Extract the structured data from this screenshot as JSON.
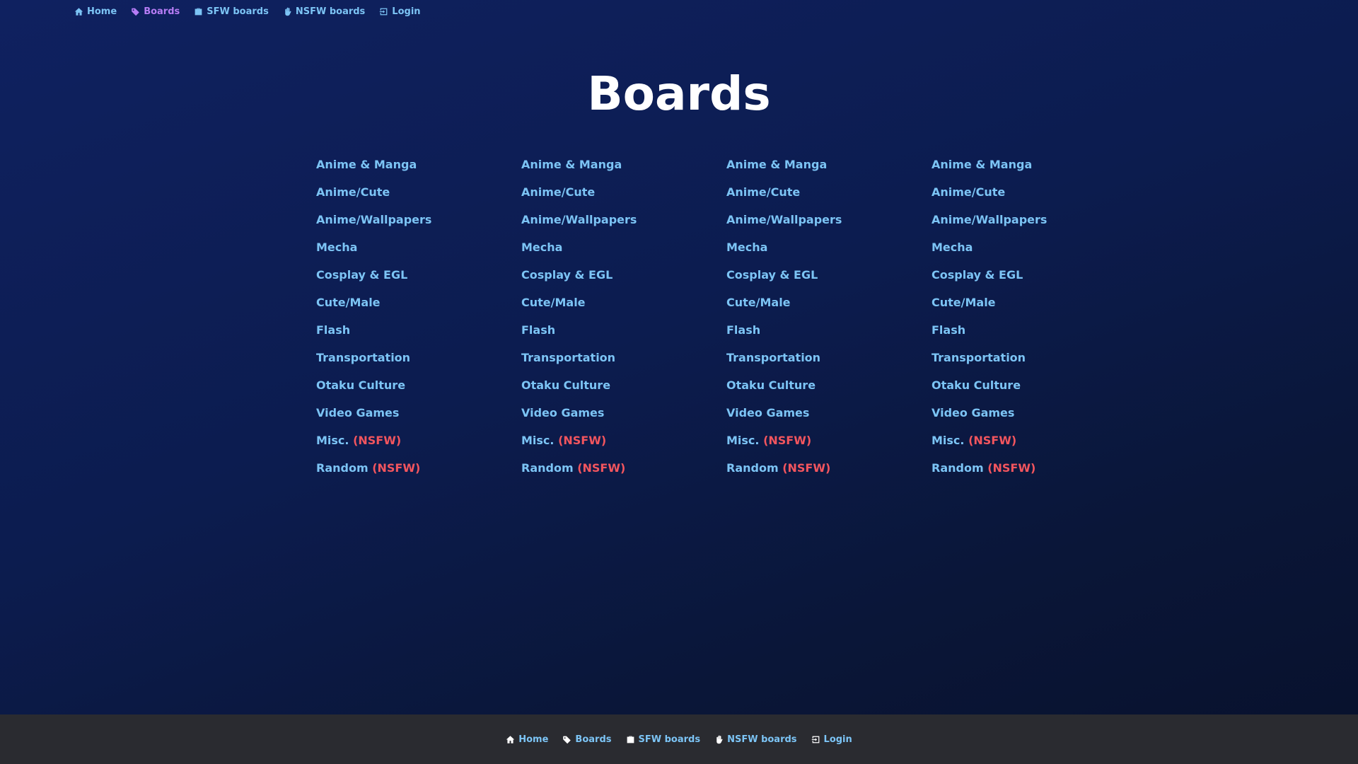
{
  "nav": {
    "items": [
      {
        "label": "Home",
        "icon": "home-icon"
      },
      {
        "label": "Boards",
        "icon": "tag-icon",
        "active": true
      },
      {
        "label": "SFW boards",
        "icon": "briefcase-icon"
      },
      {
        "label": "NSFW boards",
        "icon": "hand-icon"
      },
      {
        "label": "Login",
        "icon": "login-icon"
      }
    ]
  },
  "title": "Boards",
  "boards": {
    "columns": [
      [
        {
          "label": "Anime & Manga"
        },
        {
          "label": "Anime/Cute"
        },
        {
          "label": "Anime/Wallpapers"
        },
        {
          "label": "Mecha"
        },
        {
          "label": "Cosplay & EGL"
        },
        {
          "label": "Cute/Male"
        },
        {
          "label": "Flash"
        },
        {
          "label": "Transportation"
        },
        {
          "label": "Otaku Culture"
        },
        {
          "label": "Video Games"
        },
        {
          "label": "Misc.",
          "tag": "(NSFW)"
        },
        {
          "label": "Random",
          "tag": "(NSFW)"
        }
      ],
      [
        {
          "label": "Anime & Manga"
        },
        {
          "label": "Anime/Cute"
        },
        {
          "label": "Anime/Wallpapers"
        },
        {
          "label": "Mecha"
        },
        {
          "label": "Cosplay & EGL"
        },
        {
          "label": "Cute/Male"
        },
        {
          "label": "Flash"
        },
        {
          "label": "Transportation"
        },
        {
          "label": "Otaku Culture"
        },
        {
          "label": "Video Games"
        },
        {
          "label": "Misc.",
          "tag": "(NSFW)"
        },
        {
          "label": "Random",
          "tag": "(NSFW)"
        }
      ],
      [
        {
          "label": "Anime & Manga"
        },
        {
          "label": "Anime/Cute"
        },
        {
          "label": "Anime/Wallpapers"
        },
        {
          "label": "Mecha"
        },
        {
          "label": "Cosplay & EGL"
        },
        {
          "label": "Cute/Male"
        },
        {
          "label": "Flash"
        },
        {
          "label": "Transportation"
        },
        {
          "label": "Otaku Culture"
        },
        {
          "label": "Video Games"
        },
        {
          "label": "Misc.",
          "tag": "(NSFW)"
        },
        {
          "label": "Random",
          "tag": "(NSFW)"
        }
      ],
      [
        {
          "label": "Anime & Manga"
        },
        {
          "label": "Anime/Cute"
        },
        {
          "label": "Anime/Wallpapers"
        },
        {
          "label": "Mecha"
        },
        {
          "label": "Cosplay & EGL"
        },
        {
          "label": "Cute/Male"
        },
        {
          "label": "Flash"
        },
        {
          "label": "Transportation"
        },
        {
          "label": "Otaku Culture"
        },
        {
          "label": "Video Games"
        },
        {
          "label": "Misc.",
          "tag": "(NSFW)"
        },
        {
          "label": "Random",
          "tag": "(NSFW)"
        }
      ]
    ]
  },
  "footer": {
    "items": [
      {
        "label": "Home",
        "icon": "home-icon"
      },
      {
        "label": "Boards",
        "icon": "tag-icon"
      },
      {
        "label": "SFW boards",
        "icon": "briefcase-icon"
      },
      {
        "label": "NSFW boards",
        "icon": "hand-icon"
      },
      {
        "label": "Login",
        "icon": "login-icon"
      }
    ]
  },
  "colors": {
    "link": "#7cc4f5",
    "active_link": "#b67cf5",
    "nsfw": "#f2555e",
    "title": "#ffffff",
    "footer_bg": "#2a2b30"
  }
}
